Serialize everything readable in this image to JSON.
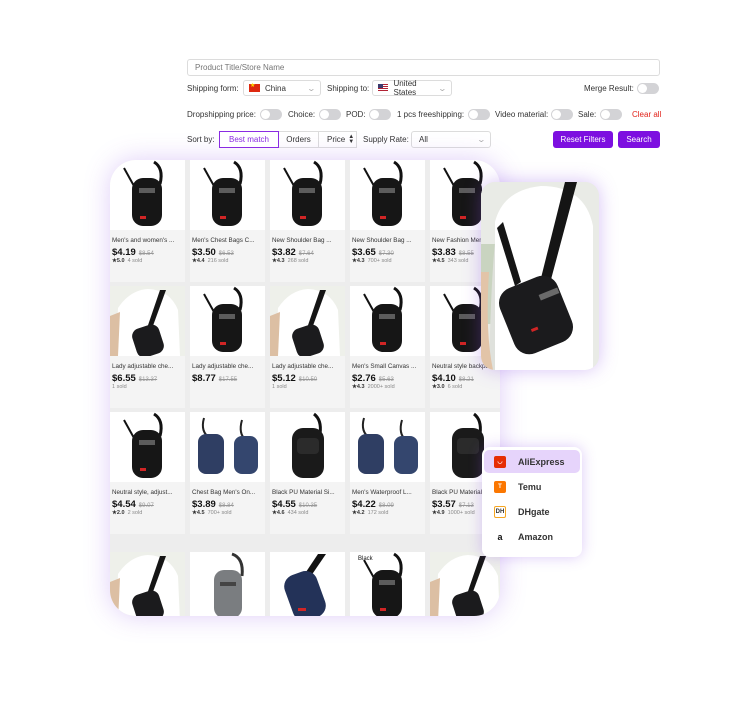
{
  "search": {
    "placeholder": "Product Title/Store Name"
  },
  "filters": {
    "shipping_from_label": "Shipping form:",
    "shipping_from_value": "China",
    "shipping_to_label": "Shipping to:",
    "shipping_to_value": "United States",
    "merge_label": "Merge Result:",
    "dropshipping_price_label": "Dropshipping price:",
    "choice_label": "Choice:",
    "pod_label": "POD:",
    "freeshipping_label": "1 pcs freeshipping:",
    "video_label": "Video material:",
    "sale_label": "Sale:",
    "clear_all": "Clear all",
    "sort_label": "Sort by:",
    "sort_options": [
      "Best match",
      "Orders",
      "Price"
    ],
    "supply_rate_label": "Supply Rate:",
    "supply_rate_value": "All",
    "reset_button": "Reset Filters",
    "search_button": "Search"
  },
  "products": [
    {
      "title": "Men's and women's ...",
      "price": "$4.19",
      "old": "$8.54",
      "rating": "★5.0",
      "sold": "4 sold",
      "img": "black"
    },
    {
      "title": "Men's Chest Bags C...",
      "price": "$3.50",
      "old": "$6.53",
      "rating": "★4.4",
      "sold": "216 sold",
      "img": "black"
    },
    {
      "title": "New Shoulder Bag ...",
      "price": "$3.82",
      "old": "$7.64",
      "rating": "★4.3",
      "sold": "268 sold",
      "img": "black"
    },
    {
      "title": "New Shoulder Bag ...",
      "price": "$3.65",
      "old": "$7.30",
      "rating": "★4.3",
      "sold": "700+ sold",
      "img": "black"
    },
    {
      "title": "New Fashion Men...",
      "price": "$3.83",
      "old": "$8.55",
      "rating": "★4.5",
      "sold": "343 sold",
      "img": "black"
    },
    {
      "title": "Lady adjustable che...",
      "price": "$6.55",
      "old": "$13.37",
      "rating": "",
      "sold": "1 sold",
      "img": "person"
    },
    {
      "title": "Lady adjustable che...",
      "price": "$8.77",
      "old": "$17.55",
      "rating": "",
      "sold": "",
      "img": "black"
    },
    {
      "title": "Lady adjustable che...",
      "price": "$5.12",
      "old": "$10.50",
      "rating": "",
      "sold": "1 sold",
      "img": "person"
    },
    {
      "title": "Men's Small Canvas ...",
      "price": "$2.76",
      "old": "$5.63",
      "rating": "★4.3",
      "sold": "2000+ sold",
      "img": "black"
    },
    {
      "title": "Neutral style backpa...",
      "price": "$4.10",
      "old": "$8.21",
      "rating": "★3.0",
      "sold": "6 sold",
      "img": "black"
    },
    {
      "title": "Neutral style, adjust...",
      "price": "$4.54",
      "old": "$9.07",
      "rating": "★2.0",
      "sold": "2 sold",
      "img": "black"
    },
    {
      "title": "Chest Bag Men's On...",
      "price": "$3.89",
      "old": "$8.84",
      "rating": "★4.5",
      "sold": "700+ sold",
      "img": "navy2"
    },
    {
      "title": "Black PU Material Si...",
      "price": "$4.55",
      "old": "$10.35",
      "rating": "★4.6",
      "sold": "434 sold",
      "img": "leather"
    },
    {
      "title": "Men's Waterproof L...",
      "price": "$4.22",
      "old": "$8.09",
      "rating": "★4.2",
      "sold": "172 sold",
      "img": "navy2"
    },
    {
      "title": "Black PU Material Si...",
      "price": "$3.57",
      "old": "$7.13",
      "rating": "★4.9",
      "sold": "1000+ sold",
      "img": "leather"
    },
    {
      "title": "",
      "price": "",
      "old": "",
      "rating": "",
      "sold": "",
      "img": "person"
    },
    {
      "title": "",
      "price": "",
      "old": "",
      "rating": "",
      "sold": "",
      "img": "gray"
    },
    {
      "title": "",
      "price": "",
      "old": "",
      "rating": "",
      "sold": "",
      "img": "navy"
    },
    {
      "title": "",
      "price": "",
      "old": "",
      "rating": "",
      "sold": "",
      "img": "black",
      "img_label": "Black"
    },
    {
      "title": "",
      "price": "",
      "old": "",
      "rating": "",
      "sold": "",
      "img": "person"
    }
  ],
  "platforms": [
    {
      "name": "AliExpress",
      "icon": "aliexpress-icon",
      "color": "#e62e04",
      "active": true
    },
    {
      "name": "Temu",
      "icon": "temu-icon",
      "color": "#fb7701",
      "active": false
    },
    {
      "name": "DHgate",
      "icon": "dhgate-icon",
      "color": "#f5a623",
      "active": false
    },
    {
      "name": "Amazon",
      "icon": "amazon-icon",
      "color": "#111111",
      "active": false
    }
  ],
  "colors": {
    "accent": "#7d0fe0",
    "clear": "#e2231a",
    "active_platform_bg": "#e6d4fb"
  }
}
